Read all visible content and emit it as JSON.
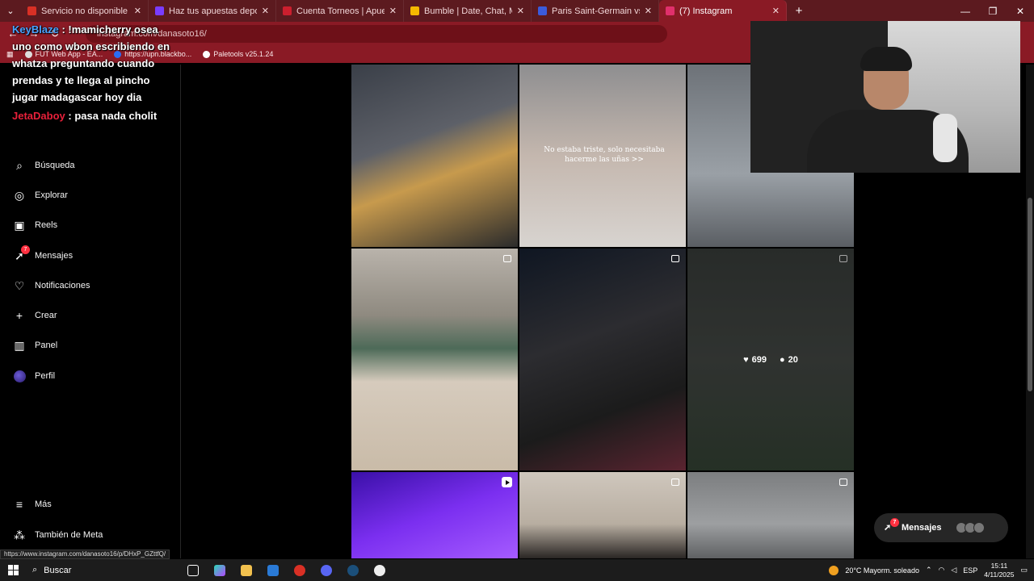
{
  "tabs": [
    {
      "label": "Servicio no disponible",
      "color": "#d93025",
      "active": false
    },
    {
      "label": "Haz tus apuestas deportivas on",
      "color": "#7a3cff",
      "active": false
    },
    {
      "label": "Cuenta Torneos | Apuesta Total",
      "color": "#cc1f2e",
      "active": false
    },
    {
      "label": "Bumble | Date, Chat, Meet New",
      "color": "#f5b800",
      "active": false
    },
    {
      "label": "Paris Saint-Germain vs FC Baye",
      "color": "#3b5bdb",
      "active": false
    },
    {
      "label": "(7) Instagram",
      "color": "#e1306c",
      "active": true
    }
  ],
  "address": {
    "url": "instagram.com/danasoto16/"
  },
  "bookmarks": [
    {
      "label": "FUT Web App - EA..."
    },
    {
      "label": "https://upn.blackbo..."
    },
    {
      "label": "Paletools v25.1.24"
    }
  ],
  "chat": {
    "msg1_user": "KeyBlaze",
    "msg1_text": ": !mamicherry osea uno como wbon escribiendo en whatza preguntando cuando prendas y te llega al pincho jugar madagascar hoy dia",
    "msg2_user": "JetaDaboy",
    "msg2_text": ": pasa nada cholit"
  },
  "sidebar": {
    "items": [
      {
        "label": "Búsqueda",
        "icon": "search-icon"
      },
      {
        "label": "Explorar",
        "icon": "compass-icon"
      },
      {
        "label": "Reels",
        "icon": "reels-icon"
      },
      {
        "label": "Mensajes",
        "icon": "messenger-icon",
        "badge": "7"
      },
      {
        "label": "Notificaciones",
        "icon": "heart-icon"
      },
      {
        "label": "Crear",
        "icon": "plus-icon"
      },
      {
        "label": "Panel",
        "icon": "chart-icon"
      },
      {
        "label": "Perfil",
        "icon": "avatar"
      }
    ],
    "more": "Más",
    "meta": "También de Meta"
  },
  "grid": {
    "overlay_text": "No estaba triste, solo necesitaba hacerme las uñas >>",
    "hover_likes": "699",
    "hover_comments": "20"
  },
  "messages_pill": {
    "label": "Mensajes",
    "badge": "7"
  },
  "status_url": "https://www.instagram.com/danasoto16/p/DHxP_GZttfQ/",
  "taskbar": {
    "search": "Buscar",
    "weather": "20°C  Mayorm. soleado",
    "lang": "ESP",
    "time": "15:11",
    "date": "4/11/2025"
  }
}
